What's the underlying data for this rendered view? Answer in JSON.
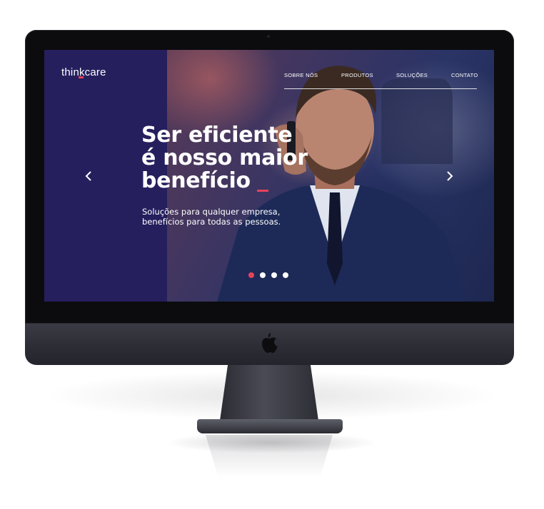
{
  "brand": {
    "name": "thinkcare",
    "accent_color": "#e8425a",
    "primary_color": "#251f5e"
  },
  "nav": {
    "items": [
      {
        "label": "SOBRE NÓS"
      },
      {
        "label": "PRODUTOS"
      },
      {
        "label": "SOLUÇÕES"
      },
      {
        "label": "CONTATO"
      }
    ]
  },
  "hero": {
    "headline_lines": [
      "Ser eficiente",
      "é nosso maior",
      "benefício"
    ],
    "subtitle_lines": [
      "Soluções para qualquer empresa,",
      "benefícios para todas as pessoas."
    ],
    "prev_icon": "chevron-left-icon",
    "next_icon": "chevron-right-icon",
    "slides": {
      "count": 4,
      "active_index": 0
    }
  },
  "device": {
    "logo_icon": "apple-logo-icon"
  }
}
